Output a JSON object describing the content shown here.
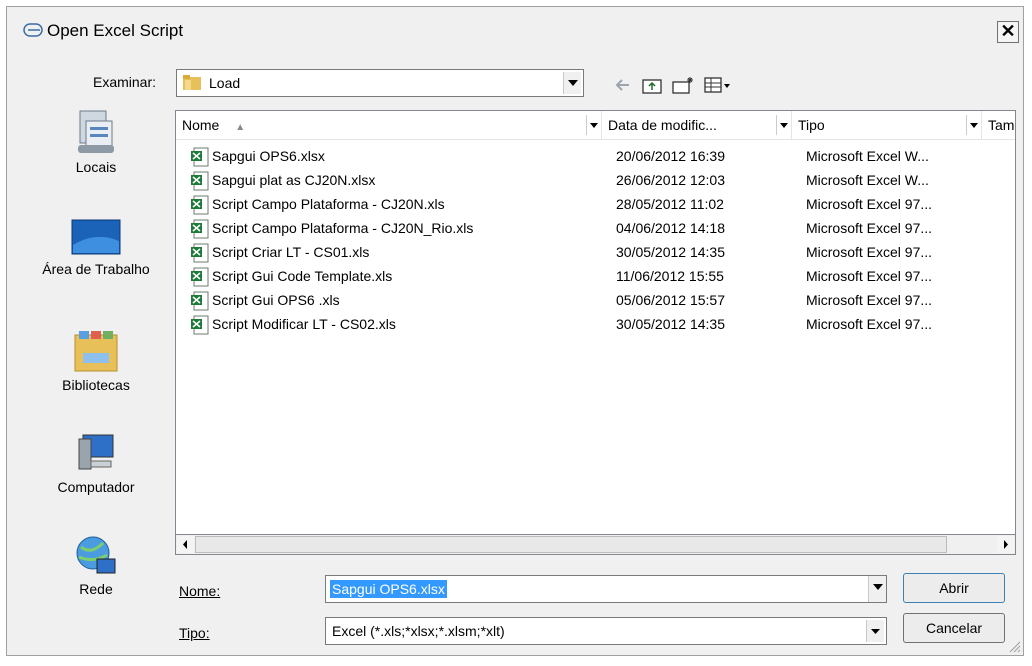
{
  "window": {
    "title": "Open Excel Script",
    "close_glyph": "✕"
  },
  "look_in": {
    "label": "Examinar:",
    "value": "Load"
  },
  "places": [
    {
      "label": "Locais",
      "icon": "recent-places-icon"
    },
    {
      "label": "Área de Trabalho",
      "icon": "desktop-icon"
    },
    {
      "label": "Bibliotecas",
      "icon": "libraries-icon"
    },
    {
      "label": "Computador",
      "icon": "computer-icon"
    },
    {
      "label": "Rede",
      "icon": "network-icon"
    }
  ],
  "columns": [
    "Nome",
    "Data de modific...",
    "Tipo",
    "Tam"
  ],
  "files": [
    {
      "name": "Sapgui OPS6.xlsx",
      "date": "20/06/2012 16:39",
      "type": "Microsoft Excel W..."
    },
    {
      "name": "Sapgui plat as CJ20N.xlsx",
      "date": "26/06/2012 12:03",
      "type": "Microsoft Excel W..."
    },
    {
      "name": "Script Campo Plataforma - CJ20N.xls",
      "date": "28/05/2012 11:02",
      "type": "Microsoft Excel 97..."
    },
    {
      "name": "Script Campo Plataforma - CJ20N_Rio.xls",
      "date": "04/06/2012 14:18",
      "type": "Microsoft Excel 97..."
    },
    {
      "name": "Script Criar LT - CS01.xls",
      "date": "30/05/2012 14:35",
      "type": "Microsoft Excel 97..."
    },
    {
      "name": "Script Gui Code Template.xls",
      "date": "11/06/2012 15:55",
      "type": "Microsoft Excel 97..."
    },
    {
      "name": "Script Gui OPS6 .xls",
      "date": "05/06/2012 15:57",
      "type": "Microsoft Excel 97..."
    },
    {
      "name": "Script Modificar LT - CS02.xls",
      "date": "30/05/2012 14:35",
      "type": "Microsoft Excel 97..."
    }
  ],
  "filename": {
    "label": "Nome:",
    "value": "Sapgui OPS6.xlsx"
  },
  "filetype": {
    "label": "Tipo:",
    "value": "Excel (*.xls;*xlsx;*.xlsm;*xlt)"
  },
  "buttons": {
    "open": "Abrir",
    "cancel": "Cancelar"
  },
  "colors": {
    "selection": "#3399ff",
    "excel_green": "#1f7a3a"
  }
}
